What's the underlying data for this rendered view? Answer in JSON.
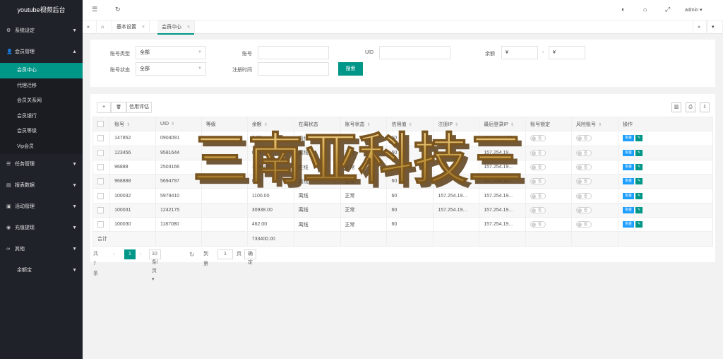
{
  "app_title": "youtube视频后台",
  "sidebar": {
    "groups": [
      {
        "label": "系统设定",
        "icon": "gear-icon"
      },
      {
        "label": "会员管理",
        "icon": "user-icon"
      },
      {
        "label": "任务管理",
        "icon": "list-icon"
      },
      {
        "label": "报表数据",
        "icon": "chart-icon"
      },
      {
        "label": "活动管理",
        "icon": "gift-icon"
      },
      {
        "label": "充值提现",
        "icon": "wallet-icon"
      },
      {
        "label": "其他",
        "icon": "more-icon"
      },
      {
        "label": "余额宝",
        "icon": ""
      }
    ],
    "subitems": [
      "会员中心",
      "代理迁移",
      "会员关系网",
      "会员银行",
      "会员等级",
      "Vip会员"
    ]
  },
  "topbar": {
    "user": "admin"
  },
  "tabs": {
    "home": "基本设置",
    "current": "会员中心"
  },
  "filter": {
    "account_type_label": "账号类型",
    "account_type_value": "全部",
    "account_label": "账号",
    "uid_label": "UID",
    "balance_label": "余额",
    "balance_min": "¥",
    "balance_sep": "-",
    "balance_max": "¥",
    "account_status_label": "账号状态",
    "account_status_value": "全部",
    "reg_time_label": "注册时间",
    "search_btn": "搜索"
  },
  "toolbar": {
    "add": "+",
    "delete": "🗑",
    "credit": "信用评估"
  },
  "table": {
    "headers": [
      "账号",
      "UID",
      "等级",
      "余额",
      "在离状态",
      "账号状态",
      "信用值",
      "注册IP",
      "最后登录IP",
      "账号锁定",
      "风险账号",
      "操作"
    ],
    "rows": [
      [
        "147852",
        "0904091",
        "",
        "0.00",
        "离线",
        "正常",
        "60",
        "",
        "192.168.1.50",
        "否",
        "否"
      ],
      [
        "123456",
        "9581644",
        "",
        "0.00",
        "离线",
        "正常",
        "60",
        "",
        "157.254.19...",
        "否",
        "否"
      ],
      [
        "96888",
        "2503166",
        "",
        "1000.00",
        "在线",
        "正常",
        "60",
        "",
        "157.254.19...",
        "否",
        "否"
      ],
      [
        "968888",
        "5694797",
        "",
        "0.00",
        "离线",
        "正常",
        "60",
        "",
        "157.254.19...",
        "否",
        "否"
      ],
      [
        "100032",
        "5979410",
        "",
        "1100.00",
        "离线",
        "正常",
        "60",
        "157.254.19...",
        "157.254.19...",
        "否",
        "否"
      ],
      [
        "100031",
        "1242175",
        "",
        "30938.00",
        "离线",
        "正常",
        "60",
        "157.254.19...",
        "157.254.19...",
        "否",
        "否"
      ],
      [
        "100030",
        "1187080",
        "",
        "462.00",
        "离线",
        "正常",
        "60",
        "",
        "157.254.19...",
        "否",
        "否"
      ]
    ],
    "total_label": "合计",
    "total_balance": "733400.00",
    "op_fund": "资金",
    "op_edit": "✎"
  },
  "pager": {
    "total": "共 7 条",
    "current": "1",
    "per_page": "10 条/页",
    "goto": "到第",
    "page_input": "1",
    "page_unit": "页",
    "confirm": "确定"
  },
  "watermark": {
    "text": "三南亚科技三"
  }
}
